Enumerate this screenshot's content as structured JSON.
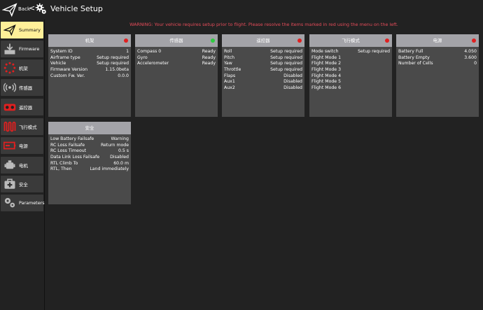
{
  "header": {
    "back_label": "Back",
    "back_chevron": "<",
    "title": "Vehicle Setup"
  },
  "warning": "WARNING: Your vehicle requires setup prior to flight. Please resolve the items marked in red using the menu on the left.",
  "colors": {
    "accent": "#fff099",
    "error": "#e74c5a",
    "ok": "#2ecc40",
    "card_header": "#a3a3a8",
    "card_body": "#4a4a4a"
  },
  "sidebar": {
    "items": [
      {
        "label": "Summary",
        "icon": "paper-plane-icon"
      },
      {
        "label": "Firmware",
        "icon": "download-icon"
      },
      {
        "label": "机架",
        "icon": "airframe-icon"
      },
      {
        "label": "传感器",
        "icon": "sensor-icon"
      },
      {
        "label": "遥控器",
        "icon": "radio-icon"
      },
      {
        "label": "飞行模式",
        "icon": "flight-mode-icon"
      },
      {
        "label": "电源",
        "icon": "battery-icon"
      },
      {
        "label": "电机",
        "icon": "motor-icon"
      },
      {
        "label": "安全",
        "icon": "safety-icon"
      },
      {
        "label": "Parameters",
        "icon": "gears-icon"
      }
    ]
  },
  "cards": {
    "airframe": {
      "title": "机架",
      "status": "error",
      "rows": [
        {
          "k": "System ID",
          "v": "1"
        },
        {
          "k": "Airframe type",
          "v": "Setup required"
        },
        {
          "k": "Vehicle",
          "v": "Setup required"
        },
        {
          "k": "Firmware Version",
          "v": "1.15.0beta"
        },
        {
          "k": "Custom Fw. Ver.",
          "v": "0.0.0"
        }
      ]
    },
    "sensors": {
      "title": "传感器",
      "status": "ok",
      "rows": [
        {
          "k": "Compass 0",
          "v": "Ready"
        },
        {
          "k": "Gyro",
          "v": "Ready"
        },
        {
          "k": "Accelerometer",
          "v": "Ready"
        }
      ]
    },
    "radio": {
      "title": "遥控器",
      "status": "error",
      "rows": [
        {
          "k": "Roll",
          "v": "Setup required"
        },
        {
          "k": "Pitch",
          "v": "Setup required"
        },
        {
          "k": "Yaw",
          "v": "Setup required"
        },
        {
          "k": "Throttle",
          "v": "Setup required"
        },
        {
          "k": "Flaps",
          "v": "Disabled"
        },
        {
          "k": "Aux1",
          "v": "Disabled"
        },
        {
          "k": "Aux2",
          "v": "Disabled"
        }
      ]
    },
    "flight_modes": {
      "title": "飞行模式",
      "status": "error",
      "rows": [
        {
          "k": "Mode switch",
          "v": "Setup required"
        },
        {
          "k": "Flight Mode 1",
          "v": ""
        },
        {
          "k": "Flight Mode 2",
          "v": ""
        },
        {
          "k": "Flight Mode 3",
          "v": ""
        },
        {
          "k": "Flight Mode 4",
          "v": ""
        },
        {
          "k": "Flight Mode 5",
          "v": ""
        },
        {
          "k": "Flight Mode 6",
          "v": ""
        }
      ]
    },
    "power": {
      "title": "电源",
      "status": "error",
      "rows": [
        {
          "k": "Battery Full",
          "v": "4.050"
        },
        {
          "k": "Battery Empty",
          "v": "3.600"
        },
        {
          "k": "Number of Cells",
          "v": "0"
        }
      ]
    },
    "safety": {
      "title": "安全",
      "status": "none",
      "rows": [
        {
          "k": "Low Battery Failsafe",
          "v": "Warning"
        },
        {
          "k": "RC Loss Failsafe",
          "v": "Return mode"
        },
        {
          "k": "RC Loss Timeout",
          "v": "0.5 s"
        },
        {
          "k": "Data Link Loss Failsafe",
          "v": "Disabled"
        },
        {
          "k": "RTL Climb To",
          "v": "60.0 m"
        },
        {
          "k": "RTL, Then",
          "v": "Land immediately"
        }
      ]
    }
  }
}
